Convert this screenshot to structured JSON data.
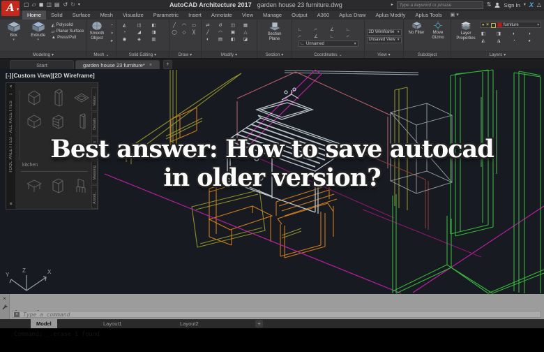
{
  "window": {
    "logo_letter": "A",
    "app_title": "AutoCAD Architecture 2017",
    "doc_title": "garden house 23 furniture.dwg",
    "search_placeholder": "Type a keyword or phrase",
    "sign_in": "Sign In"
  },
  "icons": {
    "dropdown": "▾",
    "dropdown_small": "⌄",
    "close": "×",
    "plus": "+",
    "undo": "↺",
    "redo": "↻",
    "search_go": "▸",
    "exchange": "⇅",
    "help_triangle": "△",
    "x_app": "X",
    "autohide": "↔",
    "properties": "≡",
    "prompt": "»",
    "sun": "☀",
    "bulb": "●",
    "camera": "▣"
  },
  "qat_icons": [
    "▢",
    "▱",
    "◼",
    "◫",
    "▤"
  ],
  "ribbon": {
    "tabs": [
      "Home",
      "Solid",
      "Surface",
      "Mesh",
      "Visualize",
      "Parametric",
      "Insert",
      "Annotate",
      "View",
      "Manage",
      "Output",
      "A360",
      "Aplus Draw",
      "Aplus Modify",
      "Aplus Tools"
    ],
    "active_tab": "Home",
    "panels": {
      "modeling": {
        "label": "Modeling",
        "box": "Box",
        "extrude": "Extrude",
        "polysolid": "Polysolid",
        "planar_surface": "Planar Surface",
        "press_pull": "Press/Pull",
        "row_icons": [
          "◭",
          "▱",
          "▲"
        ]
      },
      "mesh": {
        "label": "Mesh",
        "smooth_object": "Smooth Object",
        "icons": [
          "◔",
          "◑",
          "◕"
        ]
      },
      "solid_editing": {
        "label": "Solid Editing",
        "icons": [
          "◭",
          "◫",
          "◧",
          "◔",
          "◢",
          "◨",
          "◉",
          "◈",
          "▥"
        ]
      },
      "draw": {
        "label": "Draw",
        "icons": [
          "╱",
          "◠",
          "▭",
          "◯",
          "◇",
          "╳"
        ]
      },
      "modify": {
        "label": "Modify",
        "icons": [
          "⇄",
          "↺",
          "◫",
          "▦",
          "╱",
          "◠",
          "▣",
          "△",
          "◐",
          "▤",
          "◧",
          "◪"
        ]
      },
      "section": {
        "label": "Section",
        "section_plane": "Section Plane"
      },
      "coordinates": {
        "label": "Coordinates",
        "view_name": "Unnamed",
        "icons": [
          "∟",
          "⌐",
          "∠",
          "∟",
          "⌐",
          "∠",
          "∟",
          "⌐"
        ]
      },
      "view": {
        "label": "View",
        "visual_style": "2D Wireframe",
        "view_dropdown": "Unsaved View"
      },
      "subobject": {
        "label": "Subobject",
        "no_filter": "No Filter",
        "move_gizmo": "Move Gizmo"
      },
      "layers": {
        "label": "Layers",
        "layer_properties": "Layer Properties",
        "current_layer": "furniture",
        "icons": [
          "◧",
          "◨",
          "◐",
          "◑",
          "◭",
          "◮",
          "◔",
          "◕"
        ]
      }
    }
  },
  "file_tabs": {
    "start": "Start",
    "active_doc": "garden house 23 furniture*",
    "new_tab": "+"
  },
  "viewport": {
    "label": "[-][Custom View][2D Wireframe]",
    "overlay_line1": "Best answer: How to save autocad",
    "overlay_line2": "in older version?",
    "ucs": {
      "x": "X",
      "y": "Y",
      "z": "Z"
    }
  },
  "tool_palette": {
    "title": "TOOL PALETTES - ALL PALETTES",
    "group_label": "kitchen",
    "tabs": [
      "Mater...",
      "Details",
      "Interiors",
      "Massing",
      "Annot..."
    ]
  },
  "command": {
    "history": [
      "Command:",
      "Command: _.erase 1 found"
    ],
    "placeholder": "Type a command"
  },
  "layout_tabs": {
    "model": "Model",
    "layout1": "Layout1",
    "layout2": "Layout2",
    "new": "+"
  },
  "colors": {
    "accent_red": "#c5281c",
    "titlebar_bg": "#2b2b2d",
    "ribbon_bg": "#3a3a3c",
    "viewport_bg": "#171b21",
    "command_bg": "#9c9c9c",
    "wire_olive": "#8f8f2d",
    "wire_orange": "#d07c1d",
    "wire_green": "#38b43c",
    "wire_green_light": "#74da74",
    "wire_magenta": "#b81f9e",
    "wire_purple": "#8c1570",
    "wire_salmon": "#c2606b",
    "wire_darkred": "#8a3d3d",
    "wire_gray": "#9aa2a8",
    "wire_white": "#bac4ca",
    "layer_swatch_red": "#b02020"
  }
}
